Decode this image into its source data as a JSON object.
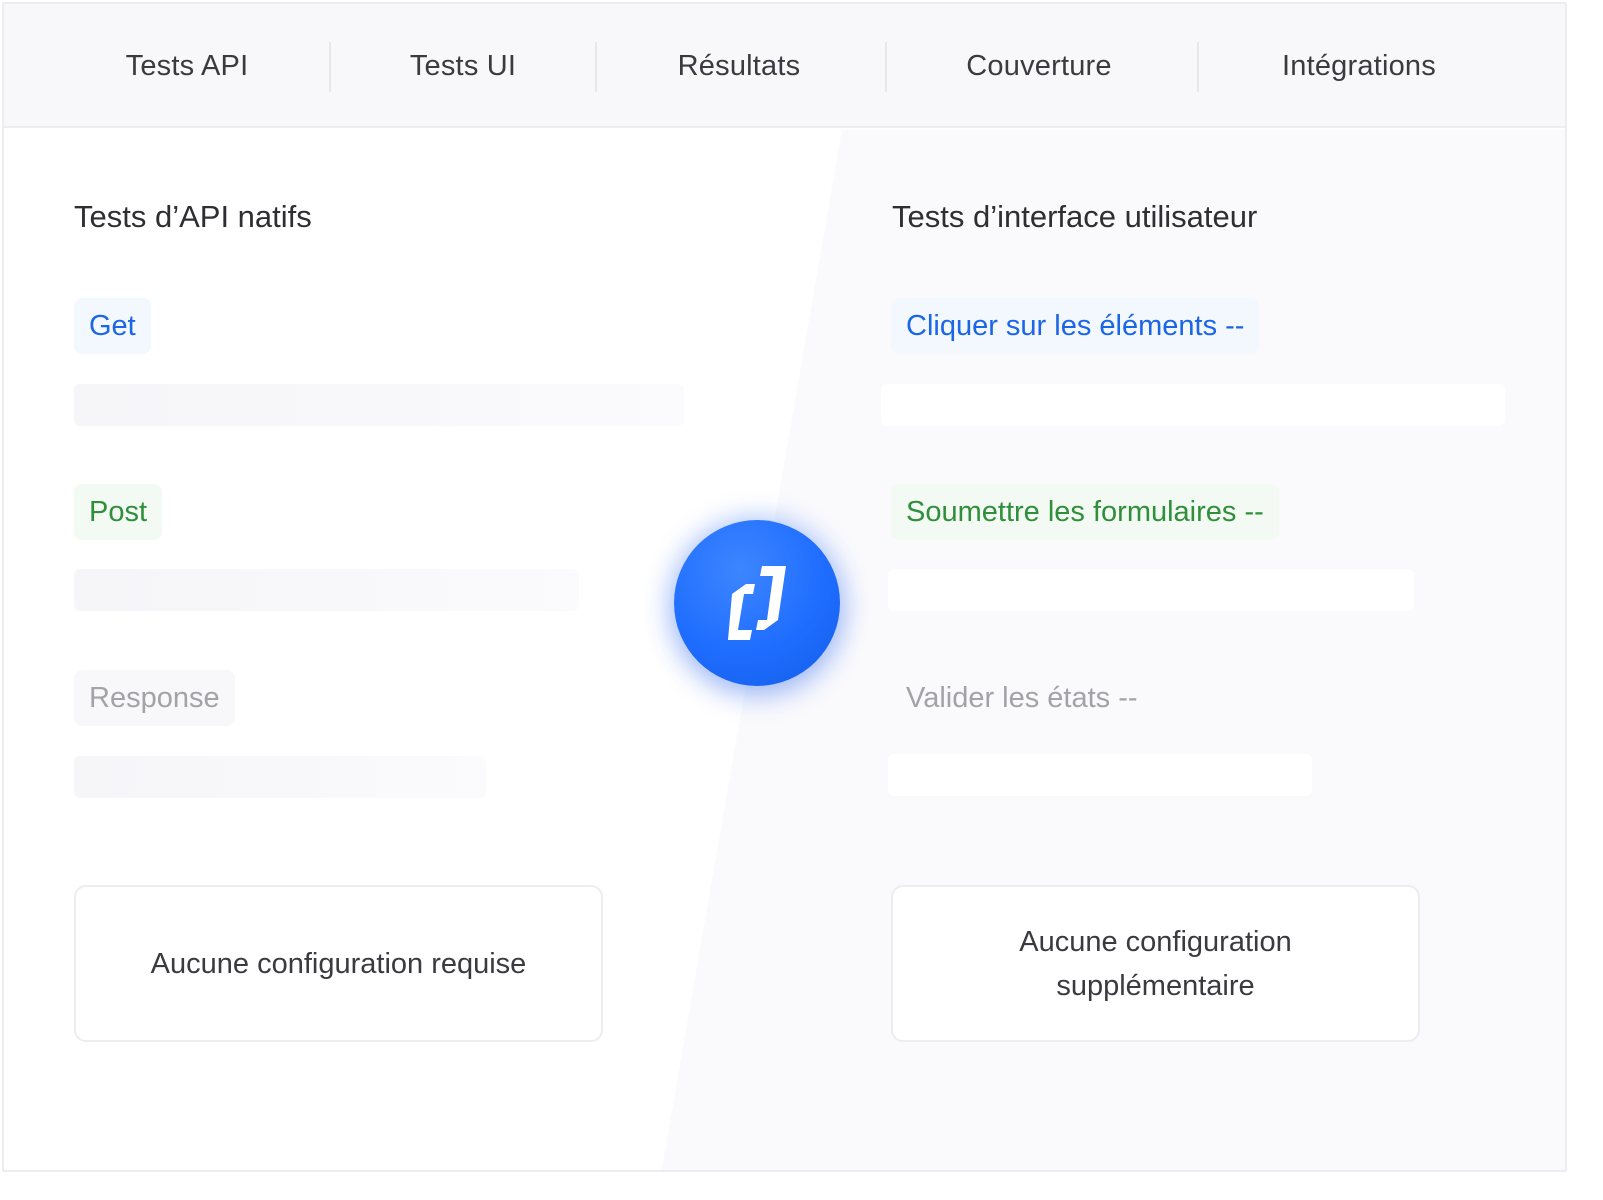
{
  "nav": {
    "items": [
      {
        "label": "Tests API"
      },
      {
        "label": "Tests UI"
      },
      {
        "label": "Résultats"
      },
      {
        "label": "Couverture"
      },
      {
        "label": "Intégrations"
      }
    ]
  },
  "left": {
    "title": "Tests d’API natifs",
    "tags": [
      {
        "label": "Get"
      },
      {
        "label": "Post"
      },
      {
        "label": "Response"
      }
    ],
    "card": "Aucune configuration requise"
  },
  "right": {
    "title": "Tests d’interface utilisateur",
    "tags": [
      {
        "label": "Cliquer sur les éléments --"
      },
      {
        "label": "Soumettre les formulaires --"
      },
      {
        "label": "Valider les états --"
      }
    ],
    "card": "Aucune configuration supplémentaire"
  },
  "colors": {
    "accent_blue": "#1a66e6",
    "accent_green": "#2f8f3a",
    "muted_gray": "#a2a2a8",
    "logo_blue": "#1f6dff"
  },
  "icons": {
    "logo": "brand-logo-icon"
  }
}
